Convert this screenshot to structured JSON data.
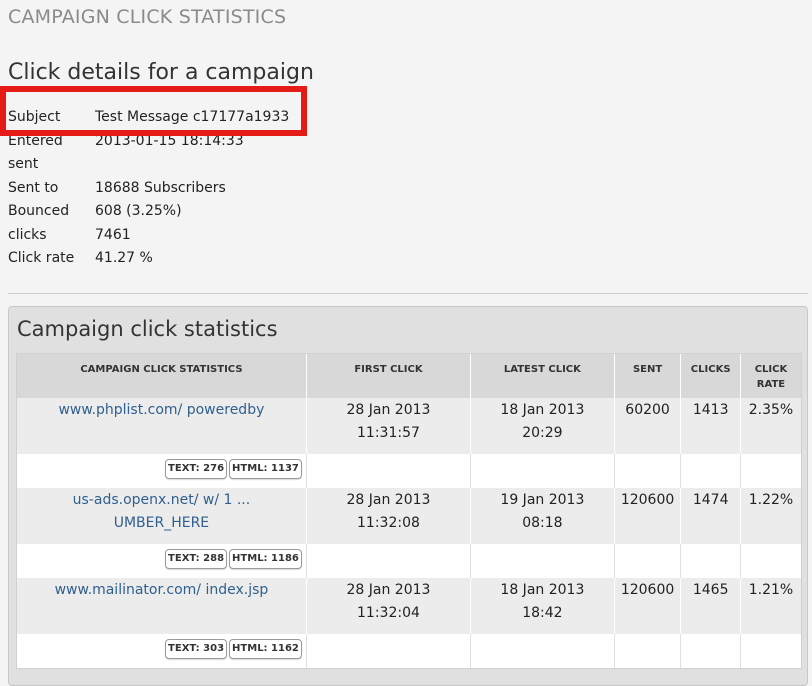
{
  "page": {
    "header": "CAMPAIGN CLICK STATISTICS",
    "details_title": "Click details for a campaign",
    "highlight_color": "#e41b17"
  },
  "details": [
    {
      "label": "Subject",
      "value": "Test Message c17177a1933"
    },
    {
      "label": "Entered",
      "value": "2013-01-15 18:14:33"
    },
    {
      "label": "sent",
      "value": ""
    },
    {
      "label": "Sent to",
      "value": "18688 Subscribers"
    },
    {
      "label": "Bounced",
      "value": "608 (3.25%)"
    },
    {
      "label": "clicks",
      "value": "7461"
    },
    {
      "label": "Click rate",
      "value": "41.27 %"
    }
  ],
  "panel": {
    "title": "Campaign click statistics",
    "columns": {
      "url": "CAMPAIGN CLICK STATISTICS",
      "first_click": "FIRST CLICK",
      "latest_click": "LATEST CLICK",
      "sent": "SENT",
      "clicks": "CLICKS",
      "click_rate_1": "CLICK",
      "click_rate_2": "RATE"
    },
    "rows": [
      {
        "url_line1": "www.phplist.com/ poweredby",
        "url_line2": "",
        "first_date": "28 Jan 2013",
        "first_time": "11:31:57",
        "latest_date": "18 Jan 2013",
        "latest_time": "20:29",
        "sent": "60200",
        "clicks": "1413",
        "rate": "2.35%",
        "text_tag": "TEXT: 276",
        "html_tag": "HTML: 1137"
      },
      {
        "url_line1": "us-ads.openx.net/ w/ 1 ...",
        "url_line2": "UMBER_HERE",
        "first_date": "28 Jan 2013",
        "first_time": "11:32:08",
        "latest_date": "19 Jan 2013",
        "latest_time": "08:18",
        "sent": "120600",
        "clicks": "1474",
        "rate": "1.22%",
        "text_tag": "TEXT: 288",
        "html_tag": "HTML: 1186"
      },
      {
        "url_line1": "www.mailinator.com/ index.jsp",
        "url_line2": "",
        "first_date": "28 Jan 2013",
        "first_time": "11:32:04",
        "latest_date": "18 Jan 2013",
        "latest_time": "18:42",
        "sent": "120600",
        "clicks": "1465",
        "rate": "1.21%",
        "text_tag": "TEXT: 303",
        "html_tag": "HTML: 1162"
      }
    ]
  }
}
